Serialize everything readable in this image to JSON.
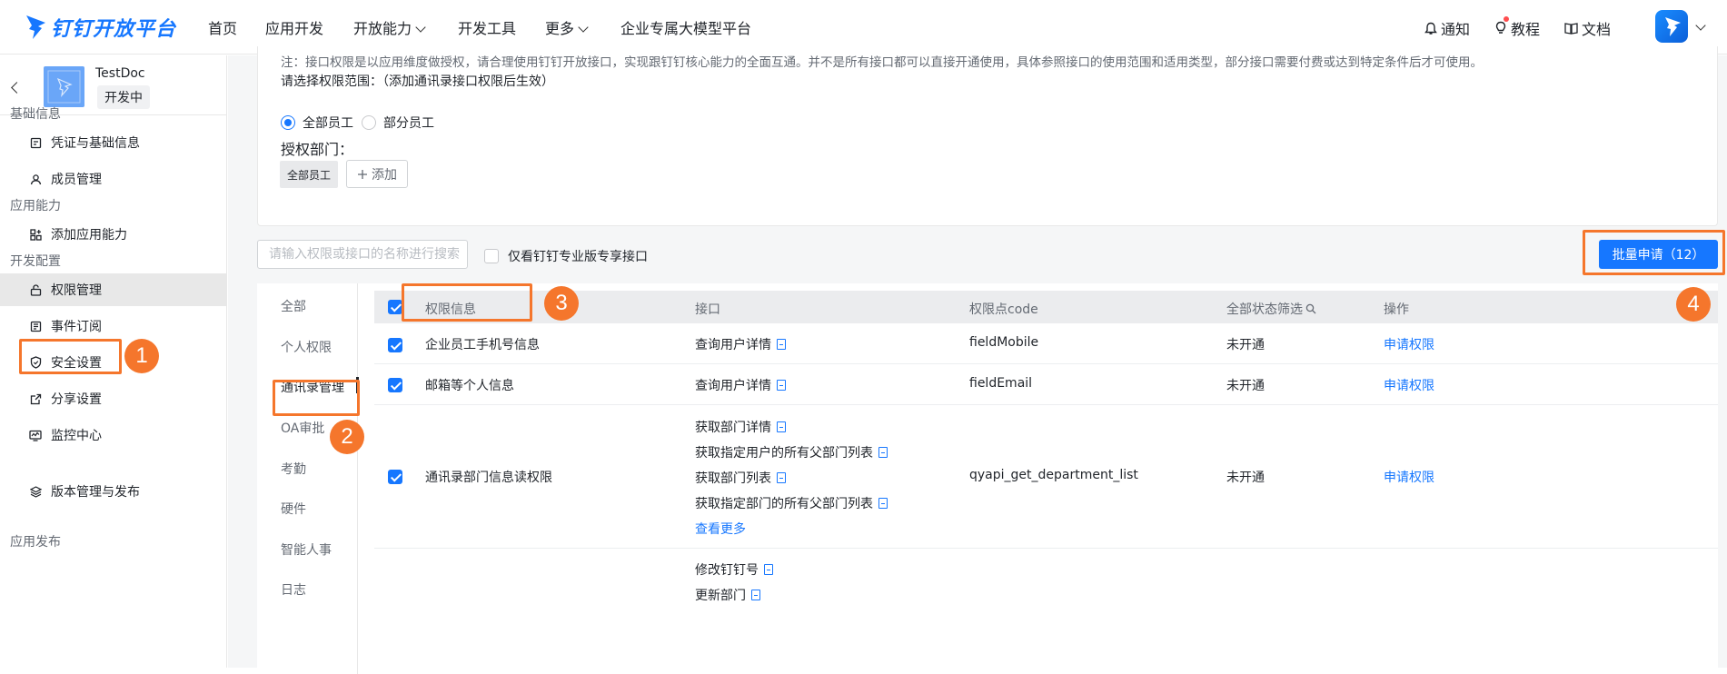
{
  "brand": {
    "logo_text": "钉钉开放平台",
    "accent": "#1677ff",
    "annotation_color": "#f5762c"
  },
  "topnav": {
    "items": [
      "首页",
      "应用开发",
      "开放能力",
      "开发工具",
      "更多",
      "企业专属大模型平台"
    ],
    "right": {
      "notify": "通知",
      "tutorial": "教程",
      "docs": "文档"
    }
  },
  "sidebar": {
    "app_name": "TestDoc",
    "app_status": "开发中",
    "sections": [
      {
        "title": "基础信息",
        "items": [
          "凭证与基础信息",
          "成员管理"
        ]
      },
      {
        "title": "应用能力",
        "items": [
          "添加应用能力"
        ]
      },
      {
        "title": "开发配置",
        "items": [
          "权限管理",
          "事件订阅",
          "安全设置",
          "分享设置",
          "监控中心"
        ]
      },
      {
        "title": "应用发布",
        "items": [
          "版本管理与发布"
        ]
      }
    ],
    "active_item": "权限管理"
  },
  "scope": {
    "note": "注：接口权限是以应用维度做授权，请合理使用钉钉开放接口，实现跟钉钉核心能力的全面互通。并不是所有接口都可以直接开通使用，具体参照接口的使用范围和适用类型，部分接口需要付费或达到特定条件后才可使用。",
    "label": "请选择权限范围：（添加通讯录接口权限后生效）",
    "radio_all": "全部员工",
    "radio_part": "部分员工",
    "dept_label": "授权部门：",
    "dept_tag": "全部员工",
    "add_label": "添加"
  },
  "toolbar": {
    "search_placeholder": "请输入权限或接口的名称进行搜索",
    "only_pro_label": "仅看钉钉专业版专享接口",
    "batch_label": "批量申请（12）"
  },
  "categories": [
    "全部",
    "个人权限",
    "通讯录管理",
    "OA审批",
    "考勤",
    "硬件",
    "智能人事",
    "日志"
  ],
  "active_category": "通讯录管理",
  "table": {
    "headers": {
      "perm": "权限信息",
      "api": "接口",
      "code": "权限点code",
      "status": "全部状态",
      "filter": "筛选",
      "action": "操作"
    },
    "rows": [
      {
        "perm": "企业员工手机号信息",
        "apis": [
          "查询用户详情"
        ],
        "code": "fieldMobile",
        "status": "未开通",
        "action": "申请权限"
      },
      {
        "perm": "邮箱等个人信息",
        "apis": [
          "查询用户详情"
        ],
        "code": "fieldEmail",
        "status": "未开通",
        "action": "申请权限"
      },
      {
        "perm": "通讯录部门信息读权限",
        "apis": [
          "获取部门详情",
          "获取指定用户的所有父部门列表",
          "获取部门列表",
          "获取指定部门的所有父部门列表"
        ],
        "more": "查看更多",
        "code": "qyapi_get_department_list",
        "status": "未开通",
        "action": "申请权限"
      },
      {
        "perm": "",
        "apis": [
          "修改钉钉号",
          "更新部门"
        ],
        "code": "",
        "status": "",
        "action": ""
      }
    ]
  },
  "annotations": [
    "1",
    "2",
    "3",
    "4"
  ]
}
